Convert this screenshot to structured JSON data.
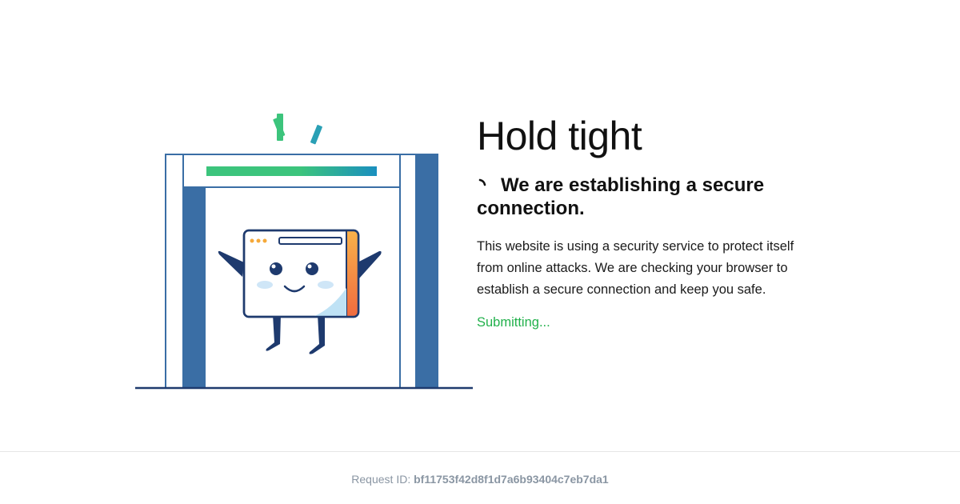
{
  "main": {
    "title": "Hold tight",
    "status_heading": "We are establishing a secure connection.",
    "description": "This website is using a security service to protect itself from online attacks. We are checking your browser to establish a secure connection and keep you safe.",
    "submit_status": "Submitting..."
  },
  "footer": {
    "request_label": "Request ID:",
    "request_id": "bf11753f42d8f1d7a6b93404c7eb7da1"
  },
  "icons": {
    "spinner": "loading-spinner-icon",
    "illustration": "security-gate-browser-character"
  },
  "colors": {
    "success_text": "#22b14c",
    "gate_blue": "#3a6ea5",
    "navy": "#1e3a6e",
    "gradient_start": "#3cc47c",
    "gradient_end": "#1a8fbf",
    "muted_text": "#8a96a3"
  }
}
